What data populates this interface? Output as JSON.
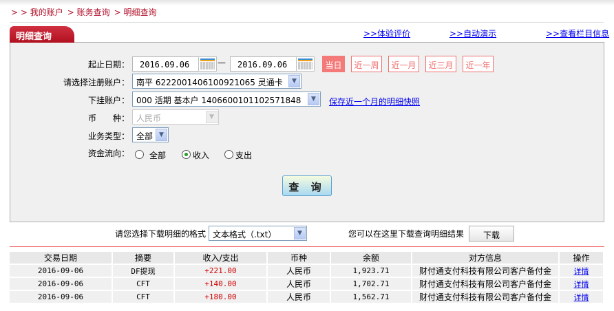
{
  "breadcrumb": [
    "> > 我的账户",
    "> 账务查询",
    "> 明细查询"
  ],
  "tab_title": "明细查询",
  "top_links": [
    ">>体验评价",
    ">>自动演示",
    ">>查看栏目信息"
  ],
  "form": {
    "date_label": "起止日期：",
    "start_date": "2016.09.06",
    "dash": "—",
    "end_date": "2016.09.06",
    "quick_ranges": [
      {
        "label": "当日",
        "active": true
      },
      {
        "label": "近一周"
      },
      {
        "label": "近一月"
      },
      {
        "label": "近三月"
      },
      {
        "label": "近一年"
      }
    ],
    "reg_account_label": "请选择注册账户：",
    "reg_account": "南平 6222001406100921065 灵通卡",
    "sub_account_label": "下挂账户：",
    "sub_account": "000 活期 基本户 1406600101102571848",
    "snapshot_link": "保存近一个月的明细快照",
    "currency_label": "币　　种：",
    "currency": "人民币",
    "biz_type_label": "业务类型：",
    "biz_type": "全部",
    "flow_label": "资金流向：",
    "flow_options": [
      "全部",
      "收入",
      "支出"
    ],
    "flow_selected": "收入",
    "query_button": "查 询"
  },
  "download": {
    "format_label": "请您选择下载明细的格式",
    "format": "文本格式（.txt）",
    "hint": "您可以在这里下载查询明细结果",
    "button": "下载"
  },
  "table": {
    "headers": [
      "交易日期",
      "摘要",
      "收入/支出",
      "币种",
      "余额",
      "对方信息",
      "操作"
    ],
    "rows": [
      [
        "2016-09-06",
        "DF提现",
        "+221.00",
        "人民币",
        "1,923.71",
        "财付通支付科技有限公司客户备付金",
        "详情"
      ],
      [
        "2016-09-06",
        "CFT",
        "+140.00",
        "人民币",
        "1,702.71",
        "财付通支付科技有限公司客户备付金",
        "详情"
      ],
      [
        "2016-09-06",
        "CFT",
        "+180.00",
        "人民币",
        "1,562.71",
        "财付通支付科技有限公司客户备付金",
        "详情"
      ]
    ]
  },
  "colors": {
    "brand": "#b01020",
    "accent": "#f47a7a",
    "link": "#0000ee",
    "amount": "#d00000"
  }
}
